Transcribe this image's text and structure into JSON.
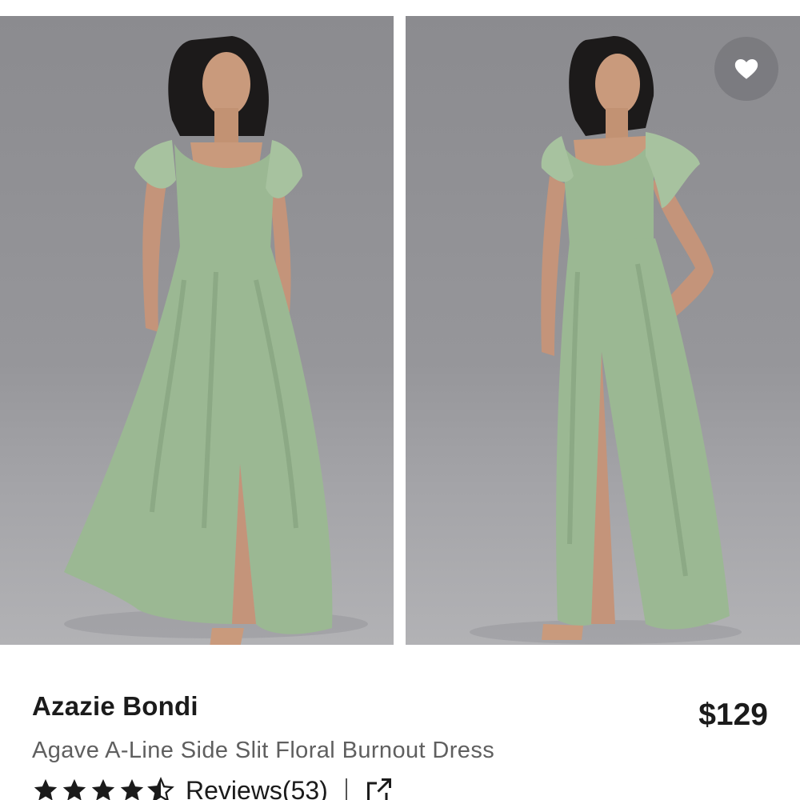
{
  "product": {
    "brand": "Azazie Bondi",
    "price": "$129",
    "name": "Agave A-Line Side Slit Floral Burnout Dress",
    "rating": 4.5,
    "reviews_label": "Reviews(53)"
  },
  "gallery": {
    "images": [
      {
        "alt": "model-front-view"
      },
      {
        "alt": "model-side-view"
      }
    ]
  },
  "icons": {
    "favorite": "heart-icon",
    "share": "external-link-icon",
    "star": "star-icon"
  },
  "colors": {
    "dress": "#9bb893",
    "dress_shadow": "#86a37f",
    "background": "#939397",
    "text_primary": "#1b1b1b",
    "text_secondary": "#5f5f5f"
  }
}
